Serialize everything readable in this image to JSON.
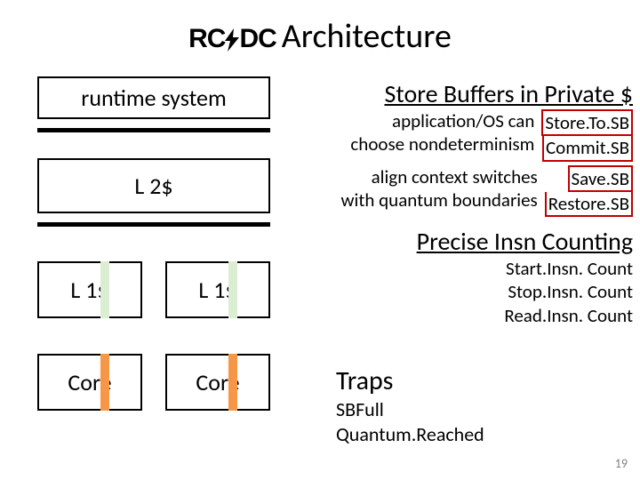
{
  "title": {
    "logo_left": "RC",
    "logo_right": "DC",
    "text": "Architecture"
  },
  "left": {
    "runtime": "runtime system",
    "l2": "L 2$",
    "l1_left": "L 1$",
    "l1_right": "L 1$",
    "core_left": "Core",
    "core_right": "Core"
  },
  "right": {
    "store_buffers": {
      "heading": "Store Buffers in Private $",
      "line1": "application/OS can",
      "line2": "choose nondeterminism",
      "api1": "Store.To.SB",
      "api2": "Commit.SB",
      "line3": "align context switches",
      "line4": "with quantum boundaries",
      "api3": "Save.SB",
      "api4": "Restore.SB"
    },
    "precise": {
      "heading": "Precise Insn Counting",
      "api1": "Start.Insn. Count",
      "api2": "Stop.Insn. Count",
      "api3": "Read.Insn. Count"
    },
    "traps": {
      "heading": "Traps",
      "line1": "SBFull",
      "line2": "Quantum.Reached"
    }
  },
  "page_number": "19",
  "colors": {
    "pale_green": "#dbeed4",
    "orange": "#f79646",
    "red": "#c00000"
  }
}
